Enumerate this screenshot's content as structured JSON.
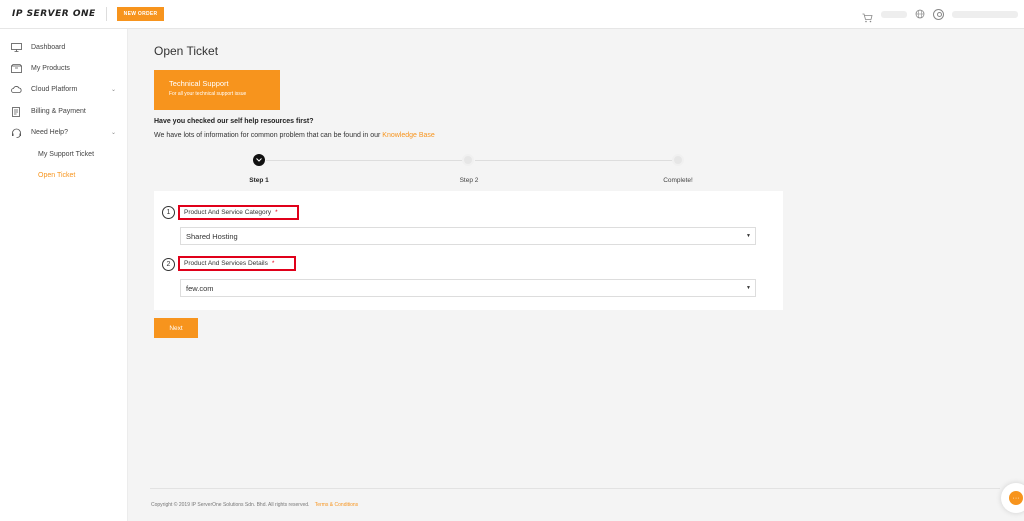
{
  "header": {
    "logo_text": "IP SERVER ONE",
    "new_order_label": "NEW ORDER"
  },
  "sidebar": {
    "items": [
      {
        "label": "Dashboard",
        "icon": "monitor-icon"
      },
      {
        "label": "My Products",
        "icon": "box-icon"
      },
      {
        "label": "Cloud Platform",
        "icon": "cloud-icon",
        "expandable": true
      },
      {
        "label": "Billing & Payment",
        "icon": "receipt-icon"
      },
      {
        "label": "Need Help?",
        "icon": "headset-icon",
        "expandable": true
      }
    ],
    "sub_items": [
      {
        "label": "My Support Ticket"
      },
      {
        "label": "Open Ticket",
        "active": true
      }
    ]
  },
  "main": {
    "title": "Open Ticket",
    "category_card": {
      "title": "Technical Support",
      "subtitle": "For all your technical support issue"
    },
    "help_question": "Have you checked our self help resources first?",
    "help_text": "We have lots of information for common problem that can be found in our",
    "knowledge_base_link": "Knowledge Base",
    "steps": [
      {
        "label": "Step 1",
        "active": true
      },
      {
        "label": "Step 2",
        "active": false
      },
      {
        "label": "Complete!",
        "active": false
      }
    ],
    "form": {
      "field1": {
        "number": "1",
        "label": "Product And Service Category",
        "required_mark": "*",
        "value": "Shared Hosting"
      },
      "field2": {
        "number": "2",
        "label": "Product And Services Details",
        "required_mark": "*",
        "value": "few.com"
      }
    },
    "next_label": "Next"
  },
  "footer": {
    "copyright": "Copyright © 2019 IP ServerOne Solutions Sdn. Bhd. All rights reserved.",
    "terms_label": "Terms & Conditions"
  },
  "colors": {
    "accent": "#f7941d",
    "highlight_border": "#e0001a"
  }
}
